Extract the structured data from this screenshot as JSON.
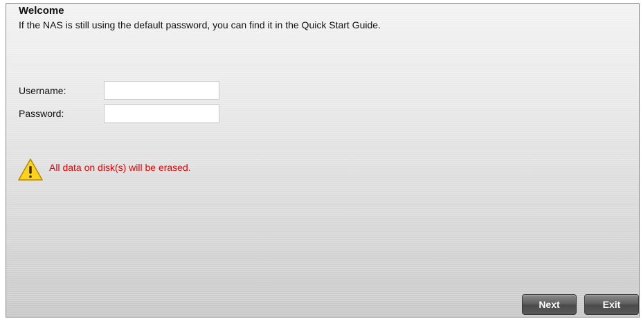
{
  "welcome": {
    "title": "Welcome",
    "description": "If the NAS is still using the default password, you can find it in the Quick Start Guide."
  },
  "form": {
    "username_label": "Username:",
    "username_value": "",
    "password_label": "Password:",
    "password_value": ""
  },
  "warning": {
    "icon": "warning-triangle-icon",
    "text": "All data on disk(s) will be erased.",
    "color": "#e60000"
  },
  "buttons": {
    "next_label": "Next",
    "exit_label": "Exit"
  }
}
